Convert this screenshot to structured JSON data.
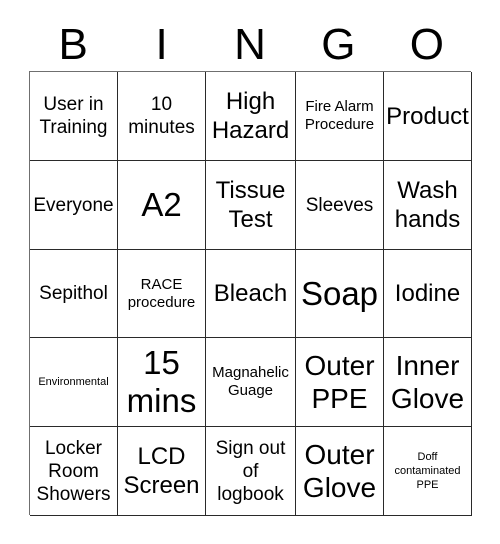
{
  "card": {
    "title_letters": [
      "B",
      "I",
      "N",
      "G",
      "O"
    ],
    "columns": 5,
    "rows": 5,
    "border_color": "#2a2a2a",
    "background_color": "#ffffff",
    "text_color": "#000000",
    "cells": [
      [
        {
          "text": "User in Training",
          "size": "md"
        },
        {
          "text": "10 minutes",
          "size": "md"
        },
        {
          "text": "High Hazard",
          "size": "lg"
        },
        {
          "text": "Fire Alarm Procedure",
          "size": "sm"
        },
        {
          "text": "Product",
          "size": "lg"
        }
      ],
      [
        {
          "text": "Everyone",
          "size": "md"
        },
        {
          "text": "A2",
          "size": "xxl"
        },
        {
          "text": "Tissue Test",
          "size": "lg"
        },
        {
          "text": "Sleeves",
          "size": "md"
        },
        {
          "text": "Wash hands",
          "size": "lg"
        }
      ],
      [
        {
          "text": "Sepithol",
          "size": "md"
        },
        {
          "text": "RACE procedure",
          "size": "sm"
        },
        {
          "text": "Bleach",
          "size": "lg"
        },
        {
          "text": "Soap",
          "size": "xxl"
        },
        {
          "text": "Iodine",
          "size": "lg"
        }
      ],
      [
        {
          "text": "Environmental",
          "size": "xs"
        },
        {
          "text": "15 mins",
          "size": "xxl"
        },
        {
          "text": "Magnahelic Guage",
          "size": "sm"
        },
        {
          "text": "Outer PPE",
          "size": "xl"
        },
        {
          "text": "Inner Glove",
          "size": "xl"
        }
      ],
      [
        {
          "text": "Locker Room Showers",
          "size": "md"
        },
        {
          "text": "LCD Screen",
          "size": "lg"
        },
        {
          "text": "Sign out of logbook",
          "size": "md"
        },
        {
          "text": "Outer Glove",
          "size": "xl"
        },
        {
          "text": "Doff contaminated PPE",
          "size": "xs"
        }
      ]
    ]
  }
}
